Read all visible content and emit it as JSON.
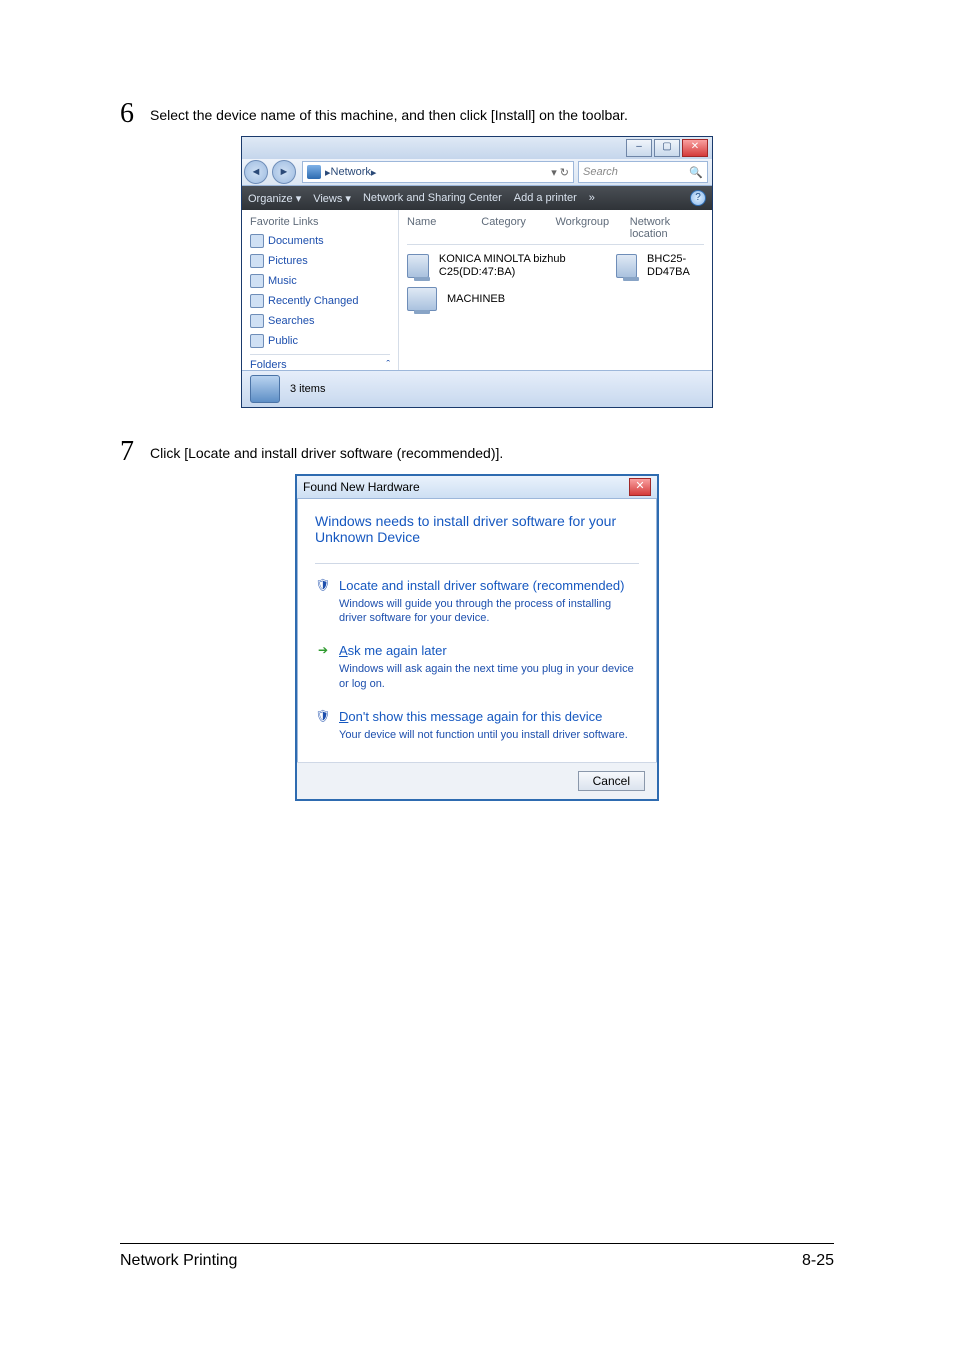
{
  "step6": {
    "num": "6",
    "text": "Select the device name of this machine, and then click [Install] on the toolbar."
  },
  "explorer": {
    "address": "Network",
    "search_placeholder": "Search",
    "toolbar": {
      "organize": "Organize ▾",
      "views": "Views ▾",
      "nsc": "Network and Sharing Center",
      "add_printer": "Add a printer",
      "more": "»"
    },
    "columns": {
      "name": "Name",
      "category": "Category",
      "workgroup": "Workgroup",
      "location": "Network location"
    },
    "nav": {
      "heading": "Favorite Links",
      "links": [
        "Documents",
        "Pictures",
        "Music",
        "Recently Changed",
        "Searches",
        "Public"
      ],
      "folders": "Folders"
    },
    "items": [
      {
        "label": "KONICA MINOLTA bizhub C25(DD:47:BA)"
      },
      {
        "label": "BHC25-DD47BA"
      },
      {
        "label": "MACHINEB"
      }
    ],
    "status": "3 items"
  },
  "step7": {
    "num": "7",
    "text": "Click [Locate and install driver software (recommended)]."
  },
  "fnh": {
    "title": "Found New Hardware",
    "heading": "Windows needs to install driver software for your Unknown Device",
    "opt1": {
      "title": "Locate and install driver software (recommended)",
      "desc": "Windows will guide you through the process of installing driver software for your device."
    },
    "opt2": {
      "title_pre": "A",
      "title_rest": "sk me again later",
      "desc": "Windows will ask again the next time you plug in your device or log on."
    },
    "opt3": {
      "title_pre": "D",
      "title_rest": "on't show this message again for this device",
      "desc": "Your device will not function until you install driver software."
    },
    "cancel": "Cancel"
  },
  "footer": {
    "left": "Network Printing",
    "right": "8-25"
  }
}
